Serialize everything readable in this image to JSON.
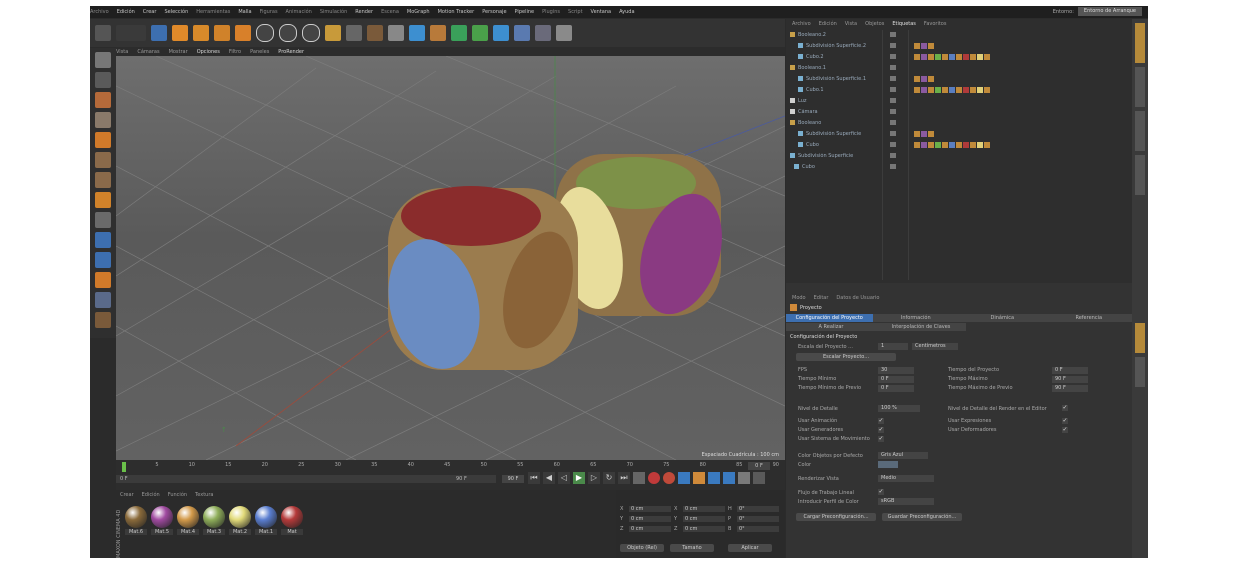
{
  "menubar": {
    "items": [
      "Archivo",
      "Edición",
      "Crear",
      "Selección",
      "Herramientas",
      "Malla",
      "Figuras",
      "Animación",
      "Simulación",
      "Render",
      "Escena",
      "MoGraph",
      "Motion Tracker",
      "Personaje",
      "Pipeline",
      "Plugins",
      "Script",
      "Ventana",
      "Ayuda"
    ],
    "layout_label": "Entorno:",
    "layout_value": "Entorno de Arranque"
  },
  "viewport": {
    "menu": [
      "Vista",
      "Cámaras",
      "Mostrar",
      "Opciones",
      "Filtro",
      "Paneles",
      "ProRender"
    ],
    "status": "Espaciado Cuadrícula : 100 cm",
    "colors": {
      "die_body": "#9b7c4e",
      "red": "#8a2c2c",
      "blue": "#6a8cc2",
      "brown": "#8a6338",
      "olive": "#7d9148",
      "yellow": "#e8dd9c",
      "purple": "#8a3a82"
    }
  },
  "timeline": {
    "ticks": [
      "0",
      "5",
      "10",
      "15",
      "20",
      "25",
      "30",
      "35",
      "40",
      "45",
      "50",
      "55",
      "60",
      "65",
      "70",
      "75",
      "80",
      "85",
      "90"
    ],
    "current_frame": "0 F",
    "start": "0 F",
    "end": "90 F",
    "end_field": "90 F"
  },
  "materials": {
    "menu": [
      "Crear",
      "Edición",
      "Función",
      "Textura"
    ],
    "items": [
      {
        "name": "Mat.6",
        "color": "#8a6a3a"
      },
      {
        "name": "Mat.5",
        "color": "#a04aa0"
      },
      {
        "name": "Mat.4",
        "color": "#d39a4a"
      },
      {
        "name": "Mat.3",
        "color": "#8fae5a"
      },
      {
        "name": "Mat.2",
        "color": "#e2db7a"
      },
      {
        "name": "Mat.1",
        "color": "#5a7ed0"
      },
      {
        "name": "Mat",
        "color": "#b53a3a"
      }
    ],
    "side_brand": "MAXON CINEMA 4D"
  },
  "coords": {
    "rows": [
      [
        "X",
        "0 cm",
        "X",
        "0 cm",
        "H",
        "0°"
      ],
      [
        "Y",
        "0 cm",
        "Y",
        "0 cm",
        "P",
        "0°"
      ],
      [
        "Z",
        "0 cm",
        "Z",
        "0 cm",
        "B",
        "0°"
      ]
    ],
    "mode": "Objeto (Rel)",
    "size_mode": "Tamaño",
    "apply": "Aplicar"
  },
  "objects": {
    "menu": [
      "Archivo",
      "Edición",
      "Vista",
      "Objetos",
      "Etiquetas",
      "Favoritos"
    ],
    "rows": [
      "Booleano.2",
      "Subdivisión Superficie.2",
      "Cubo.2",
      "Booleano.1",
      "Subdivisión Superficie.1",
      "Cubo.1",
      "Luz",
      "Cámara",
      "Booleano",
      "Subdivisión Superficie",
      "Cubo",
      "Subdivisión Superficie",
      "Cubo"
    ]
  },
  "attributes": {
    "menu": [
      "Modo",
      "Editar",
      "Datos de Usuario"
    ],
    "object": "Proyecto",
    "tabs_row1": [
      "Configuración del Proyecto",
      "Información",
      "Dinámica",
      "Referencia"
    ],
    "tabs_row2": [
      "A Realizar",
      "Interpolación de Claves"
    ],
    "section": "Configuración del Proyecto",
    "scale_label": "Escala del Proyecto ...",
    "scale_value": "1",
    "scale_unit": "Centímetros",
    "scale_button": "Escalar Proyecto...",
    "left_fields": [
      [
        "FPS",
        "30"
      ],
      [
        "Tiempo Mínimo",
        "0 F"
      ],
      [
        "Tiempo Mínimo de Previo",
        "0 F"
      ]
    ],
    "right_fields": [
      [
        "Tiempo del Proyecto",
        "0 F"
      ],
      [
        "Tiempo Máximo",
        "90 F"
      ],
      [
        "Tiempo Máximo de Previo",
        "90 F"
      ]
    ],
    "lod_label": "Nivel de Detalle",
    "lod_value": "100 %",
    "lod_render_label": "Nivel de Detalle del Render en el Editor",
    "checks_left": [
      "Usar Animación",
      "Usar Generadores",
      "Usar Sistema de Movimiento"
    ],
    "checks_right": [
      "Usar Expresiones",
      "Usar Deformadores"
    ],
    "color_label": "Color Objetos por Defecto",
    "color_value": "Gris Azul",
    "color2_label": "Color",
    "render_view_label": "Renderizar Vista",
    "render_view_value": "Medio",
    "linear_label": "Flujo de Trabajo Lineal",
    "profile_label": "Introducir Perfil de Color",
    "profile_value": "sRGB",
    "load_btn": "Cargar Preconfiguración...",
    "save_btn": "Guardar Preconfiguración..."
  }
}
